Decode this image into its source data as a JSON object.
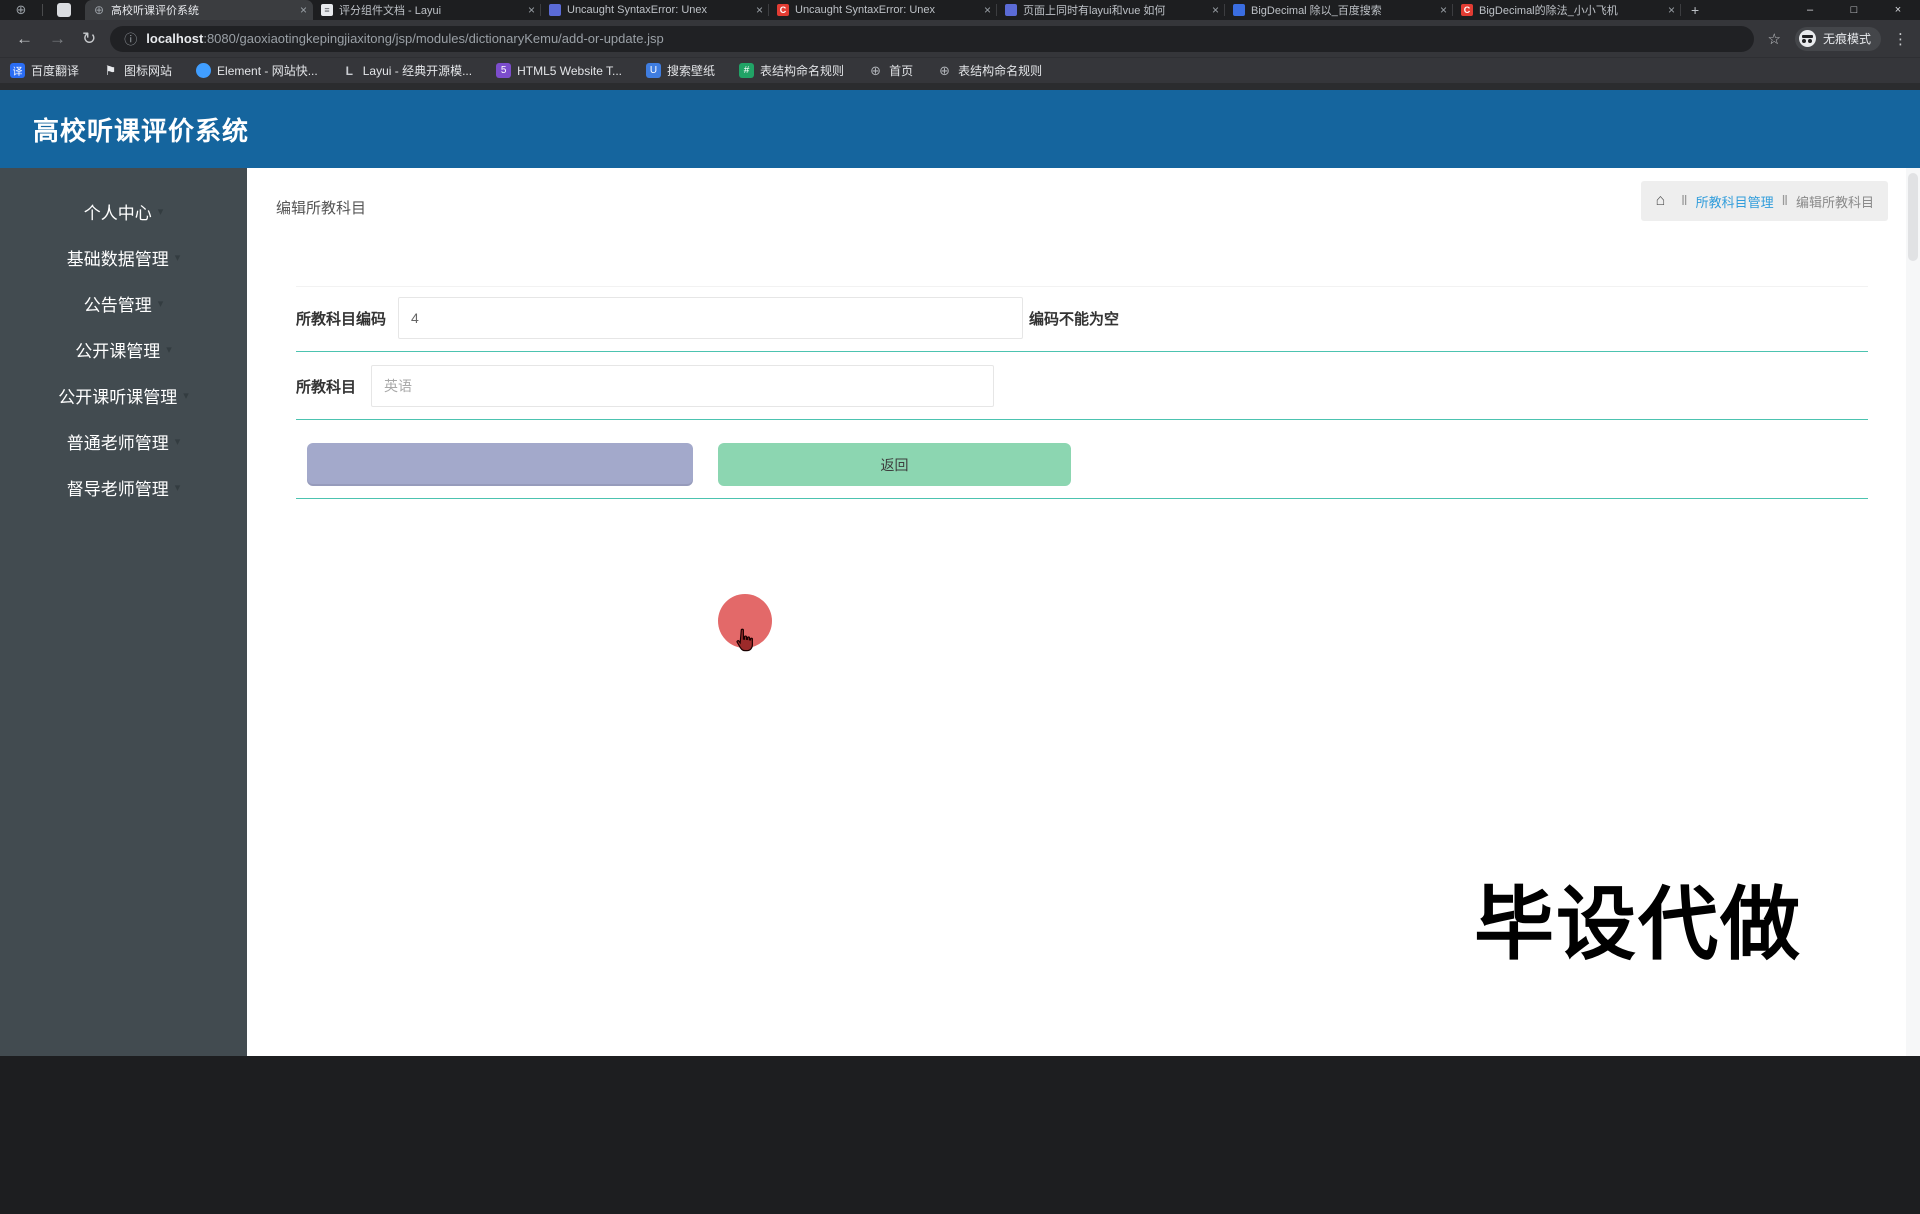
{
  "colors": {
    "header_blue": "#15659e",
    "header_circle_teal": "#27b1c5",
    "sidebar_dark": "#424b50",
    "row_separator_teal": "#4cc3b0",
    "submit_button": "#a3a9cb",
    "back_button": "#8cd6b1",
    "breadcrumb_link_blue": "#319ddb",
    "ripple_red": "#df5454",
    "backtop_green": "#2fae99",
    "watermark_black": "#000000"
  },
  "icons": {
    "home": "⌂",
    "caret": "▾",
    "close": "×",
    "back": "←",
    "forward": "→",
    "refresh": "↻",
    "info": "ⓘ",
    "star": "☆",
    "menu": "⋮",
    "plus": "+",
    "minimize": "–",
    "maximize": "□",
    "globe": "⊕"
  },
  "browser": {
    "tabs": [
      {
        "title": "高校听课评价系统",
        "icon": "globe",
        "glyph": "⊕",
        "state": "active"
      },
      {
        "title": "评分组件文档 - Layui",
        "icon": "page",
        "glyph": "≡"
      },
      {
        "title": "Uncaught SyntaxError: Unex",
        "icon": "qa",
        "glyph": ""
      },
      {
        "title": "Uncaught SyntaxError: Unex",
        "icon": "csdn",
        "glyph": "C"
      },
      {
        "title": "页面上同时有layui和vue 如何",
        "icon": "qa",
        "glyph": ""
      },
      {
        "title": "BigDecimal 除以_百度搜索",
        "icon": "baidu",
        "glyph": ""
      },
      {
        "title": "BigDecimal的除法_小小飞机",
        "icon": "csdn",
        "glyph": "C"
      }
    ],
    "url": {
      "host": "localhost",
      "rest": ":8080/gaoxiaotingkepingjiaxitong/jsp/modules/dictionaryKemu/add-or-update.jsp"
    },
    "incognito_label": "无痕模式",
    "bookmarks": [
      {
        "label": "百度翻译",
        "icon": "translate",
        "glyph": "译"
      },
      {
        "label": "图标网站",
        "icon": "flag",
        "glyph": "⚑"
      },
      {
        "label": "Element - 网站快...",
        "icon": "element",
        "glyph": ""
      },
      {
        "label": "Layui - 经典开源模...",
        "icon": "layui",
        "glyph": "L"
      },
      {
        "label": "HTML5 Website T...",
        "icon": "html5",
        "glyph": "5"
      },
      {
        "label": "搜索壁纸",
        "icon": "wall",
        "glyph": "U"
      },
      {
        "label": "表结构命名规则",
        "icon": "table",
        "glyph": "#"
      },
      {
        "label": "首页",
        "icon": "globe",
        "glyph": "⊕"
      },
      {
        "label": "表结构命名规则",
        "icon": "globe",
        "glyph": "⊕"
      }
    ]
  },
  "app": {
    "header": {
      "title": "高校听课评价系统"
    },
    "sidebar": {
      "items": [
        "个人中心",
        "基础数据管理",
        "公告管理",
        "公开课管理",
        "公开课听课管理",
        "普通老师管理",
        "督导老师管理"
      ]
    },
    "breadcrumb": {
      "sep": "Ⅱ",
      "section": "所教科目管理",
      "current": "编辑所教科目"
    },
    "page_title": "编辑所教科目",
    "form": {
      "rows": [
        {
          "label": "所教科目编码",
          "value": "4",
          "error": "编码不能为空"
        },
        {
          "label": "所教科目",
          "value": "英语"
        }
      ],
      "back_label": "返回"
    },
    "watermark": "毕设代做"
  }
}
